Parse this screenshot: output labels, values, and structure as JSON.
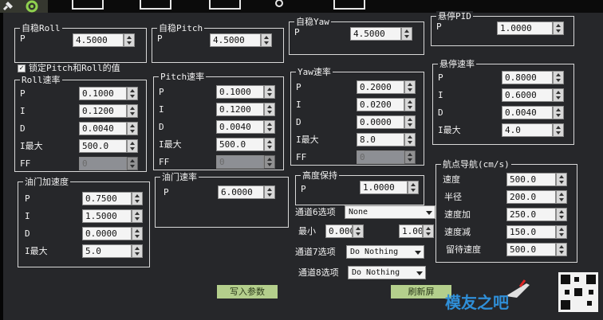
{
  "roll": {
    "title": "自稳Roll",
    "p_label": "P",
    "p_value": "4.5000"
  },
  "pitch": {
    "title": "自稳Pitch",
    "p_label": "P",
    "p_value": "4.5000"
  },
  "yaw": {
    "title": "自稳Yaw",
    "p_label": "P",
    "p_value": "4.5000"
  },
  "loiter_pid": {
    "title": "悬停PID",
    "p_label": "P",
    "p_value": "1.0000"
  },
  "lock_checkbox": {
    "label": "锁定Pitch和Roll的值",
    "checked": true
  },
  "roll_rate": {
    "title": "Roll速率",
    "rows": [
      {
        "label": "P",
        "value": "0.1000"
      },
      {
        "label": "I",
        "value": "0.1200"
      },
      {
        "label": "D",
        "value": "0.0040"
      },
      {
        "label": "I最大",
        "value": "500.0"
      },
      {
        "label": "FF",
        "value": "0"
      }
    ]
  },
  "pitch_rate": {
    "title": "Pitch速率",
    "rows": [
      {
        "label": "P",
        "value": "0.1000"
      },
      {
        "label": "I",
        "value": "0.1200"
      },
      {
        "label": "D",
        "value": "0.0040"
      },
      {
        "label": "I最大",
        "value": "500.0"
      },
      {
        "label": "FF",
        "value": "0"
      }
    ]
  },
  "yaw_rate": {
    "title": "Yaw速率",
    "rows": [
      {
        "label": "P",
        "value": "0.2000"
      },
      {
        "label": "I",
        "value": "0.0200"
      },
      {
        "label": "D",
        "value": "0.0000"
      },
      {
        "label": "I最大",
        "value": "8.0"
      },
      {
        "label": "FF",
        "value": "0"
      }
    ]
  },
  "loiter_rate": {
    "title": "悬停速率",
    "rows": [
      {
        "label": "P",
        "value": "0.8000"
      },
      {
        "label": "I",
        "value": "0.6000"
      },
      {
        "label": "D",
        "value": "0.0040"
      },
      {
        "label": "I最大",
        "value": "4.0"
      }
    ]
  },
  "throttle_accel": {
    "title": "油门加速度",
    "rows": [
      {
        "label": "P",
        "value": "0.7500"
      },
      {
        "label": "I",
        "value": "1.5000"
      },
      {
        "label": "D",
        "value": "0.0000"
      },
      {
        "label": "I最大",
        "value": "5.0"
      }
    ]
  },
  "throttle_rate": {
    "title": "油门速率",
    "p_label": "P",
    "p_value": "6.0000"
  },
  "altitude_hold": {
    "title": "高度保持",
    "p_label": "P",
    "p_value": "1.0000"
  },
  "channels": {
    "ch6_label": "通道6选项",
    "ch6_value": "None",
    "min_label": "最小",
    "min_value": "0.000",
    "max_value": "1.000",
    "ch7_label": "通道7选项",
    "ch7_value": "Do Nothing",
    "ch8_label": "通道8选项",
    "ch8_value": "Do Nothing"
  },
  "waypoint_nav": {
    "title": "航点导航(cm/s)",
    "rows": [
      {
        "label": "速度",
        "value": "500.0"
      },
      {
        "label": "半径",
        "value": "200.0"
      },
      {
        "label": "速度加",
        "value": "250.0"
      },
      {
        "label": "速度减",
        "value": "150.0"
      },
      {
        "label": "留待速度",
        "value": "500.0"
      }
    ]
  },
  "buttons": {
    "write": "写入参数",
    "refresh": "刷新屏"
  },
  "watermark": {
    "text": "模友之吧"
  },
  "colors": {
    "accent_green": "#b4cf8c",
    "panel_bg": "#26272a"
  }
}
